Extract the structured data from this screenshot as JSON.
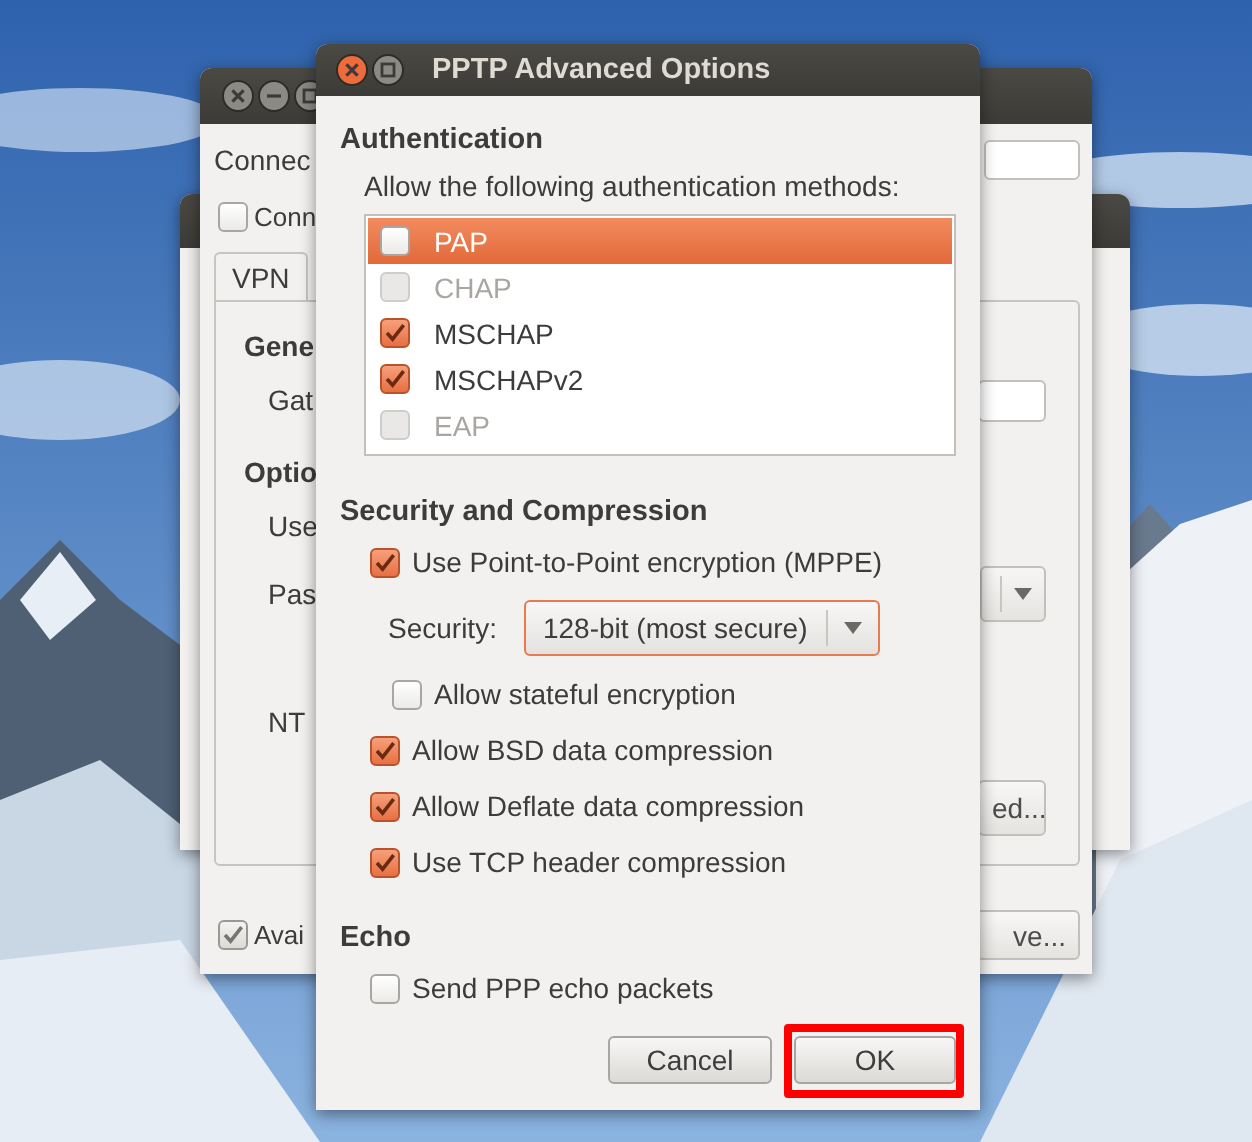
{
  "background_window": {
    "label_1": "Connec",
    "checkbox_1": {
      "label": "Conn",
      "checked": false
    },
    "tabs": [
      {
        "label": "VPN",
        "selected": true
      }
    ],
    "panel": {
      "heading_1": "Gene",
      "label_1": "Gat",
      "heading_2": "Optio",
      "label_2": "Use",
      "label_3": "Pas",
      "label_4": "NT",
      "button": "ed..."
    },
    "checkbox_2": {
      "label": "Avai",
      "checked": true
    },
    "button": "ve..."
  },
  "dialog": {
    "title": "PPTP Advanced Options",
    "sections": [
      {
        "heading": "Authentication",
        "prompt": "Allow the following authentication methods:",
        "methods": [
          {
            "label": "PAP",
            "checked": false,
            "disabled": false,
            "selected": true
          },
          {
            "label": "CHAP",
            "checked": false,
            "disabled": true,
            "selected": false
          },
          {
            "label": "MSCHAP",
            "checked": true,
            "disabled": false,
            "selected": false
          },
          {
            "label": "MSCHAPv2",
            "checked": true,
            "disabled": false,
            "selected": false
          },
          {
            "label": "EAP",
            "checked": false,
            "disabled": true,
            "selected": false
          }
        ]
      },
      {
        "heading": "Security and Compression",
        "options": [
          {
            "kind": "check",
            "label": "Use Point-to-Point encryption (MPPE)",
            "checked": true,
            "children": [
              {
                "kind": "combo",
                "label": "Security:",
                "value": "128-bit (most secure)"
              },
              {
                "kind": "check",
                "label": "Allow stateful encryption",
                "checked": false
              }
            ]
          },
          {
            "kind": "check",
            "label": "Allow BSD data compression",
            "checked": true
          },
          {
            "kind": "check",
            "label": "Allow Deflate data compression",
            "checked": true
          },
          {
            "kind": "check",
            "label": "Use TCP header compression",
            "checked": true
          }
        ]
      },
      {
        "heading": "Echo",
        "options": [
          {
            "kind": "check",
            "label": "Send PPP echo packets",
            "checked": false
          }
        ]
      }
    ],
    "buttons": [
      {
        "label": "Cancel",
        "highlighted": false
      },
      {
        "label": "OK",
        "highlighted": true
      }
    ]
  }
}
